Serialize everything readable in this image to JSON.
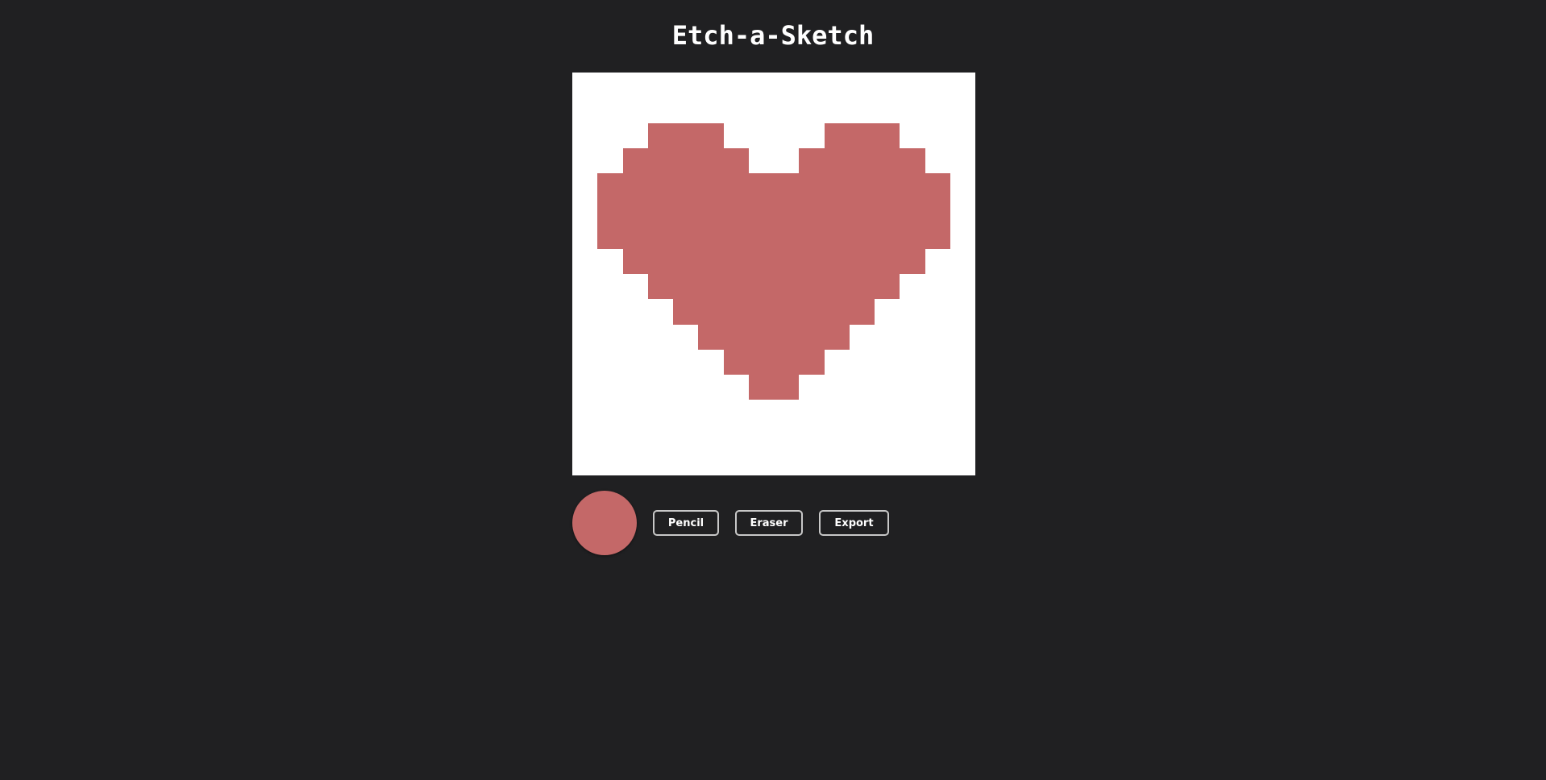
{
  "header": {
    "title": "Etch-a-Sketch"
  },
  "canvas": {
    "grid_size": 16,
    "background_color": "#ffffff",
    "paint_color": "#c46868",
    "rows": [
      "................",
      "................",
      "...###....###...",
      "..#####..#####..",
      ".##############.",
      ".##############.",
      ".##############.",
      "..############..",
      "...##########...",
      "....########....",
      ".....######.....",
      "......####......",
      ".......##.......",
      "................",
      "................",
      "................"
    ]
  },
  "toolbar": {
    "color_swatch": "#c46868",
    "pencil_label": "Pencil",
    "eraser_label": "Eraser",
    "export_label": "Export"
  }
}
